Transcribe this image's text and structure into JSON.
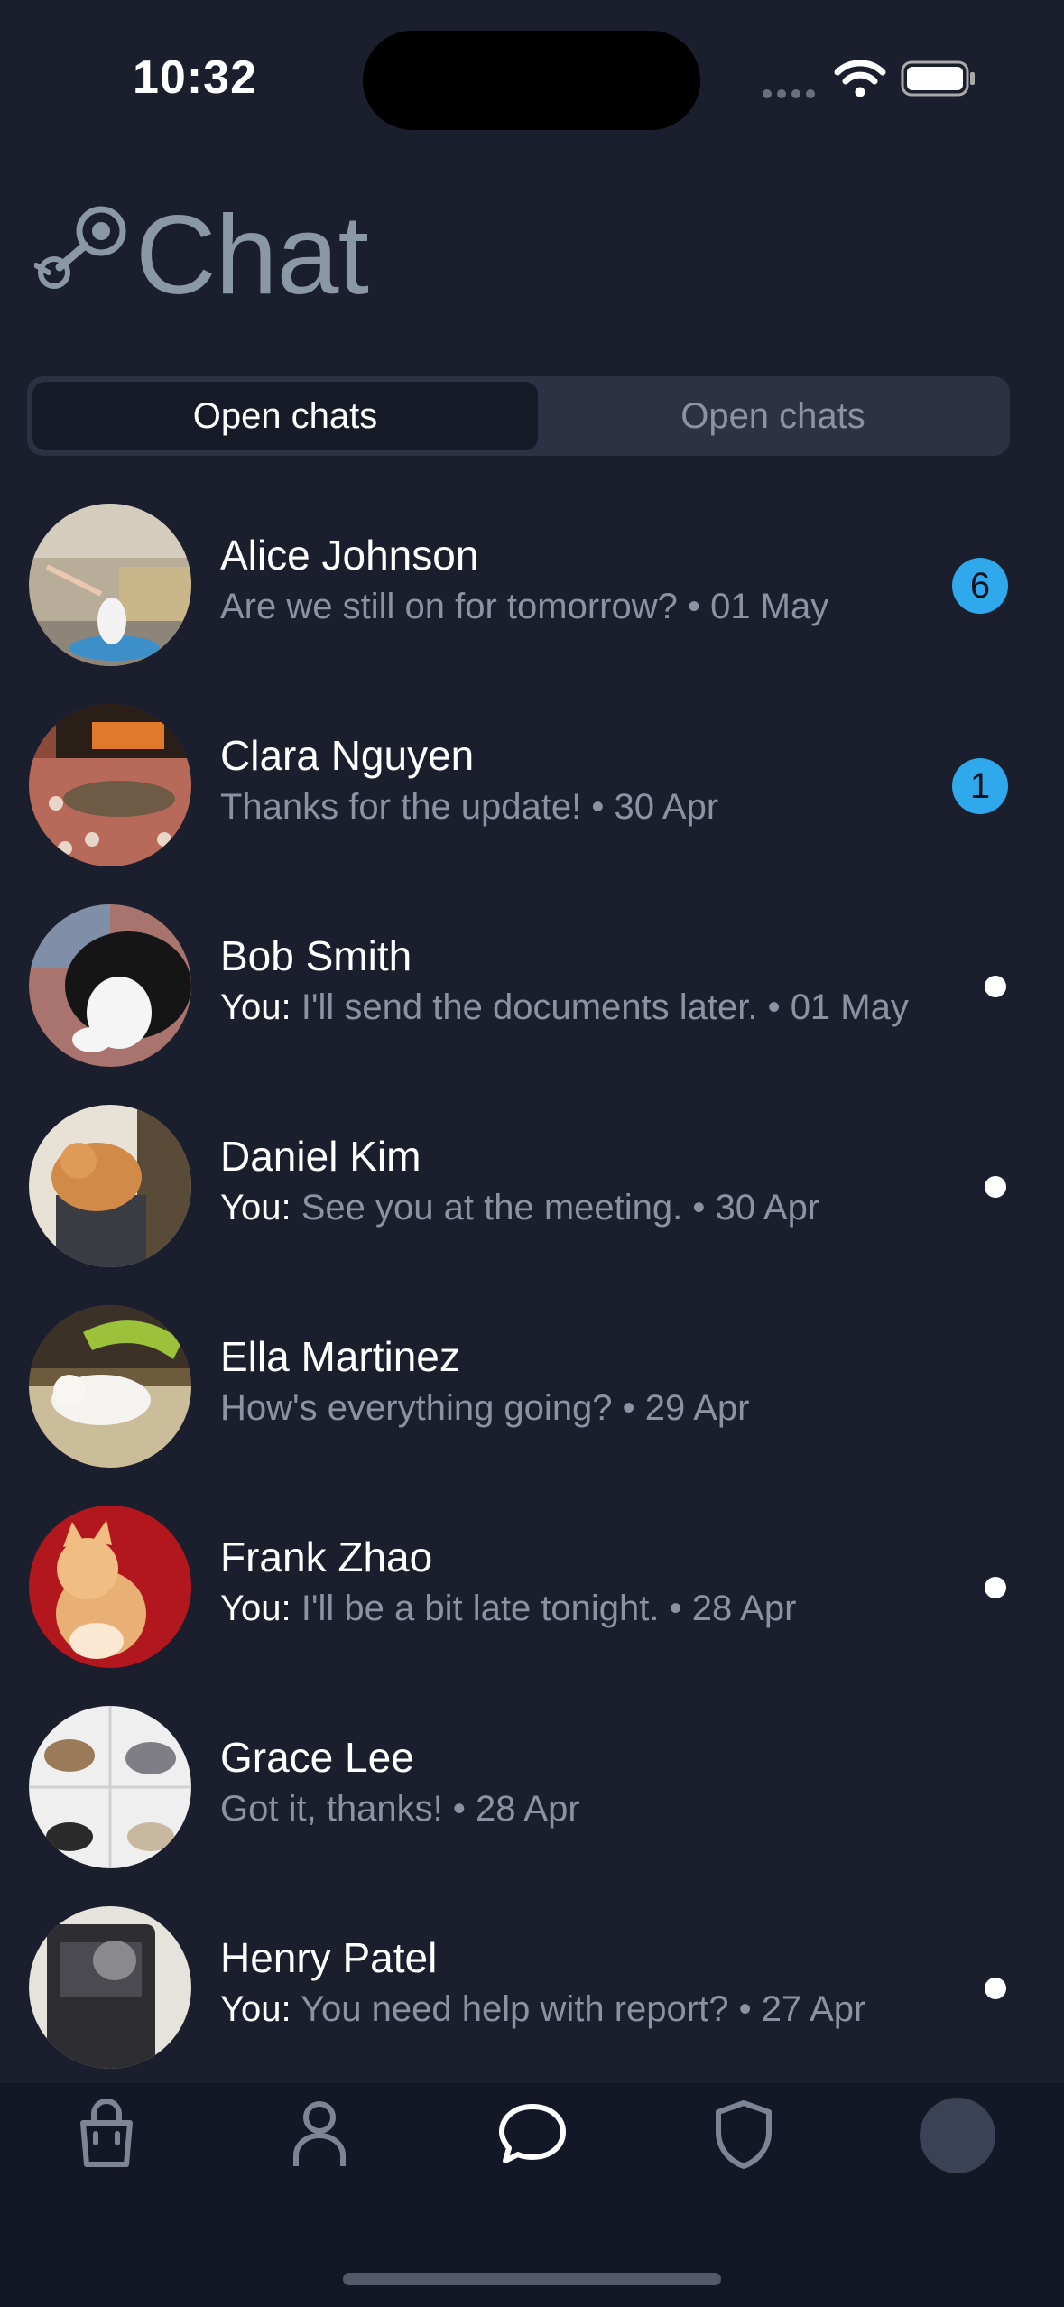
{
  "status_bar": {
    "time": "10:32"
  },
  "header": {
    "title": "Chat",
    "logo_icon": "steam-logo-icon"
  },
  "segments": {
    "left_label": "Open chats",
    "right_label": "Open chats",
    "active": "left"
  },
  "you_prefix": "You:",
  "chats": [
    {
      "name": "Alice Johnson",
      "you": false,
      "message": "Are we still on for tomorrow?",
      "date": "01 May",
      "unread": "6"
    },
    {
      "name": "Clara Nguyen",
      "you": false,
      "message": "Thanks for the update!",
      "date": "30 Apr",
      "unread": "1"
    },
    {
      "name": "Bob Smith",
      "you": true,
      "message": "I'll send the documents later.",
      "date": "01 May",
      "unread": ""
    },
    {
      "name": "Daniel Kim",
      "you": true,
      "message": "See you at the meeting.",
      "date": "30 Apr",
      "unread": ""
    },
    {
      "name": "Ella Martinez",
      "you": false,
      "message": "How's everything going?",
      "date": "29 Apr",
      "unread": ""
    },
    {
      "name": "Frank Zhao",
      "you": true,
      "message": "I'll be a bit late tonight.",
      "date": "28 Apr",
      "unread": ""
    },
    {
      "name": "Grace Lee",
      "you": false,
      "message": "Got it, thanks!",
      "date": "28 Apr",
      "unread": ""
    },
    {
      "name": "Henry Patel",
      "you": true,
      "message": "You need help with report?",
      "date": "27 Apr",
      "unread": ""
    }
  ],
  "tabbar": {
    "items": [
      "shopping-bag-icon",
      "person-icon",
      "chat-bubble-icon",
      "shield-icon",
      "profile-avatar"
    ],
    "active": "chat-bubble-icon"
  },
  "colors": {
    "background": "#1b1e2c",
    "accent": "#2fa9ec",
    "muted": "#8b92a1"
  }
}
